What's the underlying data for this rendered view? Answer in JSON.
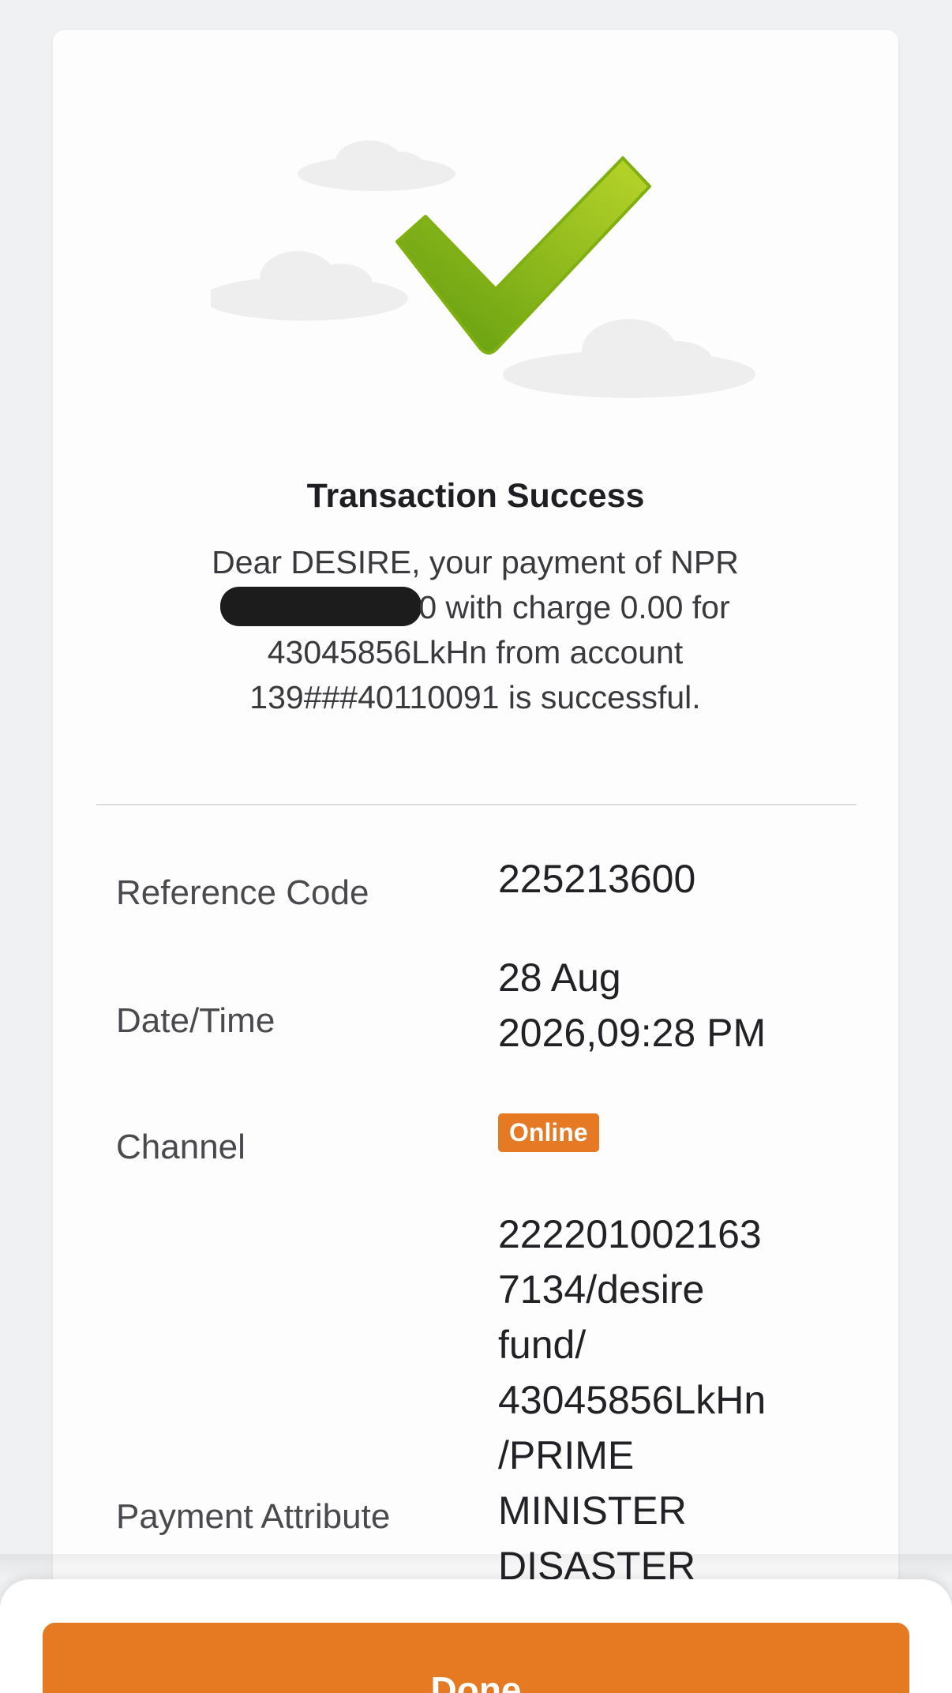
{
  "receipt": {
    "title": "Transaction Success",
    "message": {
      "line1": "Dear DESIRE, your payment of NPR",
      "line2_suffix": "0 with charge 0.00 for",
      "line3": "43045856LkHn from account",
      "line4": "139###40110091 is successful."
    },
    "rows": {
      "reference": {
        "label": "Reference Code",
        "value": "225213600"
      },
      "datetime": {
        "label": "Date/Time",
        "value_line1": "28 Aug",
        "value_line2": "2026,09:28 PM"
      },
      "channel": {
        "label": "Channel",
        "badge": "Online"
      },
      "payment_attribute": {
        "label": "Payment Attribute",
        "value_lines": [
          "222201002163",
          "7134/desire",
          "fund/",
          "43045856LkHn",
          "/PRIME",
          "MINISTER",
          "DISASTER"
        ]
      }
    },
    "icons": {
      "illustration": "checkmark-icon",
      "clouds": "cloud-icon"
    },
    "colors": {
      "accent": "#e57a22",
      "check_green": "#8cc019"
    }
  },
  "footer": {
    "done_label": "Done"
  }
}
